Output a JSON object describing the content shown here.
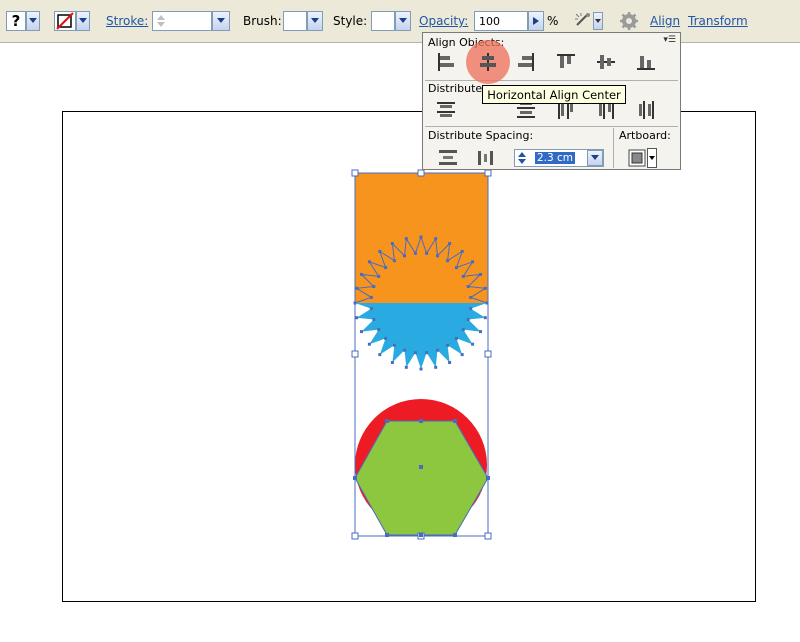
{
  "toolbar": {
    "help_glyph": "?",
    "stroke_label": "Stroke:",
    "brush_label": "Brush:",
    "style_label": "Style:",
    "opacity_label": "Opacity:",
    "opacity_value": "100",
    "percent": "%",
    "align_link": "Align",
    "transform_link": "Transform"
  },
  "align_panel": {
    "align_objects_label": "Align Objects:",
    "distribute_objects_label": "Distribute",
    "distribute_spacing_label": "Distribute Spacing:",
    "artboard_label": "Artboard:",
    "spacing_value": "2.3 cm",
    "tooltip": "Horizontal Align Center",
    "align_buttons": [
      "horizontal-align-left",
      "horizontal-align-center",
      "horizontal-align-right",
      "vertical-align-top",
      "vertical-align-center",
      "vertical-align-bottom"
    ],
    "distribute_buttons": [
      "vertical-distribute-top",
      "vertical-distribute-center",
      "vertical-distribute-bottom",
      "horizontal-distribute-left",
      "horizontal-distribute-center",
      "horizontal-distribute-right"
    ]
  },
  "canvas": {
    "colors": {
      "orange": "#f7941d",
      "blue": "#29abe2",
      "red": "#ed1c24",
      "green": "#8dc63f",
      "selection": "#4a6bc2"
    }
  }
}
